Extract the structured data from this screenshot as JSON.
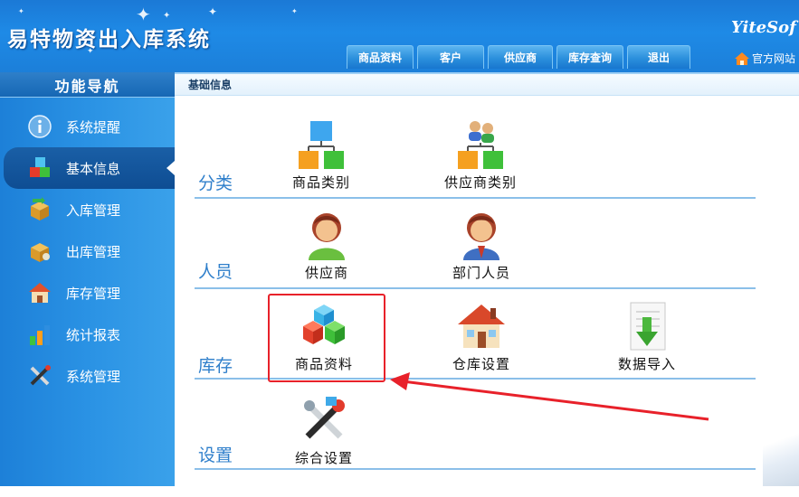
{
  "header": {
    "app_title": "易特物资出入库系统",
    "brand": "YiteSof",
    "nav_items": [
      "商品资料",
      "客户",
      "供应商",
      "库存查询",
      "退出"
    ],
    "official_site": "官方网站"
  },
  "sidebar": {
    "title": "功能导航",
    "items": [
      {
        "label": "系统提醒",
        "icon": "info-icon"
      },
      {
        "label": "基本信息",
        "icon": "cubes-icon",
        "active": true
      },
      {
        "label": "入库管理",
        "icon": "box-in-icon"
      },
      {
        "label": "出库管理",
        "icon": "box-out-icon"
      },
      {
        "label": "库存管理",
        "icon": "warehouse-icon"
      },
      {
        "label": "统计报表",
        "icon": "bar-chart-icon"
      },
      {
        "label": "系统管理",
        "icon": "tools-icon"
      }
    ]
  },
  "main": {
    "breadcrumb": "基础信息",
    "sections": [
      {
        "label": "分类",
        "tiles": [
          {
            "label": "商品类别",
            "icon": "org-chart-icon"
          },
          {
            "label": "供应商类别",
            "icon": "people-org-icon"
          }
        ]
      },
      {
        "label": "人员",
        "tiles": [
          {
            "label": "供应商",
            "icon": "person-icon"
          },
          {
            "label": "部门人员",
            "icon": "staff-icon"
          }
        ]
      },
      {
        "label": "库存",
        "tiles": [
          {
            "label": "商品资料",
            "icon": "cubes-icon"
          },
          {
            "label": "仓库设置",
            "icon": "house-icon"
          },
          {
            "label": "数据导入",
            "icon": "import-doc-icon"
          }
        ]
      },
      {
        "label": "设置",
        "tiles": [
          {
            "label": "综合设置",
            "icon": "tools-icon"
          }
        ]
      }
    ]
  },
  "colors": {
    "header_blue": "#1e8ae6",
    "sidebar_blue": "#2a92e4",
    "section_label": "#2f7fcb",
    "highlight_red": "#e8212a"
  }
}
